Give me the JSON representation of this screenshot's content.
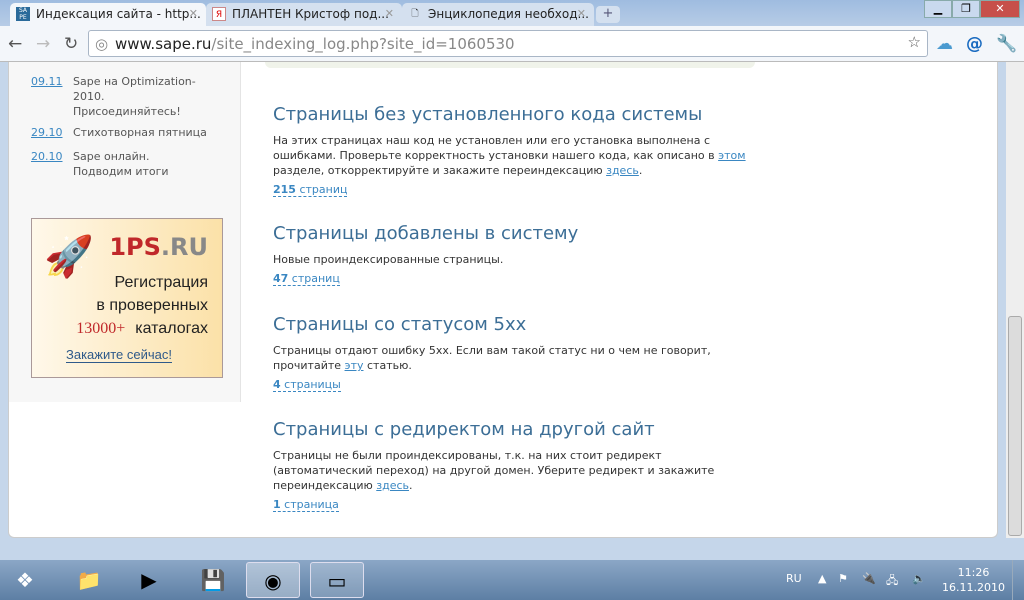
{
  "browser": {
    "tabs": [
      {
        "title": "Индексация сайта - http...",
        "favicon": "SA PE"
      },
      {
        "title": "ПЛАНТЕН Кристоф под...",
        "favicon": "Я"
      },
      {
        "title": "Энциклопедия необход...",
        "favicon": "page-icon"
      }
    ],
    "url_host": "www.sape.ru",
    "url_path": "/site_indexing_log.php?site_id=1060530"
  },
  "sidebar": {
    "news": [
      {
        "date": "09.11",
        "text": "Sape на Optimization-2010. Присоединяйтесь!"
      },
      {
        "date": "29.10",
        "text": "Стихотворная пятница"
      },
      {
        "date": "20.10",
        "text": "Sape онлайн. Подводим итоги"
      }
    ],
    "ad": {
      "brand_a": "1PS",
      "brand_b": ".RU",
      "line1": "Регистрация",
      "line2": "в проверенных",
      "num": "13000+",
      "line3": "каталогах",
      "cta": "Закажите сейчас!"
    }
  },
  "sections": [
    {
      "title": "Страницы без установленного кода системы",
      "text_a": "На этих страницах наш код не установлен или его установка выполнена с ошибками. Проверьте корректность установки нашего кода, как описано в ",
      "link1": "этом",
      "text_b": " разделе, откорректируйте и закажите переиндексацию ",
      "link2": "здесь",
      "text_c": ".",
      "count": "215",
      "unit": " страниц"
    },
    {
      "title": "Страницы добавлены в систему",
      "text_a": "Новые проиндексированные страницы.",
      "count": "47",
      "unit": " страниц"
    },
    {
      "title": "Страницы со статусом 5xx",
      "text_a": "Страницы отдают ошибку 5xx. Если вам такой статус ни о чем не говорит, прочитайте ",
      "link1": "эту",
      "text_b": " статью.",
      "count": "4",
      "unit": " страницы"
    },
    {
      "title": "Страницы с редиректом на другой сайт",
      "text_a": "Страницы не были проиндексированы, т.к. на них стоит редирект (автоматический переход) на другой домен. Уберите редирект и закажите переиндексацию ",
      "link1": "здесь",
      "text_b": ".",
      "count": "1",
      "unit": " страница"
    }
  ],
  "taskbar": {
    "lang": "RU",
    "time": "11:26",
    "date": "16.11.2010"
  }
}
